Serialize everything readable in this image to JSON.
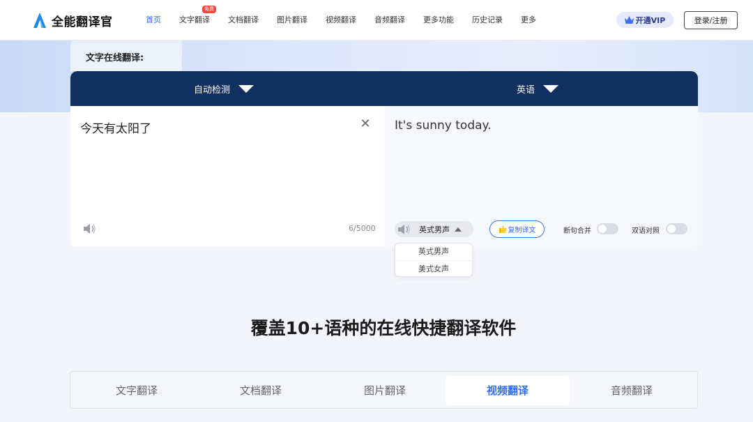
{
  "header": {
    "logo_text": "全能翻译官",
    "nav": [
      {
        "label": "首页",
        "active": true
      },
      {
        "label": "文字翻译",
        "badge": "免费"
      },
      {
        "label": "文档翻译"
      },
      {
        "label": "图片翻译"
      },
      {
        "label": "视频翻译"
      },
      {
        "label": "音频翻译"
      },
      {
        "label": "更多功能"
      },
      {
        "label": "历史记录"
      },
      {
        "label": "更多"
      }
    ],
    "vip_label": "开通VIP",
    "login_label": "登录/注册"
  },
  "section_title": "文字在线翻译:",
  "translator": {
    "source_lang": "自动检测",
    "target_lang": "英语",
    "source_text": "今天有太阳了",
    "char_count": "6/5000",
    "target_text": "It's sunny today.",
    "voice_selected": "英式男声",
    "copy_label": "复制译文",
    "toggle_merge": {
      "label": "断句合并",
      "on": false
    },
    "toggle_bilingual": {
      "label": "双语对照",
      "on": false
    },
    "voice_options": [
      "英式男声",
      "美式女声"
    ]
  },
  "headline": "覆盖10+语种的在线快捷翻译软件",
  "feature_tabs": [
    {
      "label": "文字翻译"
    },
    {
      "label": "文档翻译"
    },
    {
      "label": "图片翻译"
    },
    {
      "label": "视频翻译",
      "active": true
    },
    {
      "label": "音频翻译"
    }
  ],
  "colors": {
    "accent": "#2f6bff",
    "lang_bar": "#11305f",
    "badge": "#f2453d"
  }
}
